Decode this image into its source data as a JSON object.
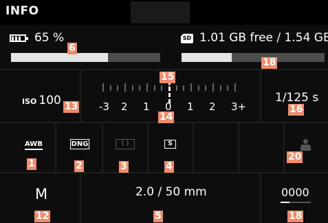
{
  "header": {
    "title": "INFO"
  },
  "battery": {
    "icon": "battery-icon",
    "text": "65 %",
    "level": 0.65
  },
  "storage": {
    "icon": "sd-card-icon",
    "sd_label": "SD",
    "text": "1.01 GB free / 1.54 GB",
    "used_fraction": 0.35
  },
  "exposure": {
    "iso_label": "ISO",
    "iso_value": "100",
    "scale_labels": [
      "-3",
      "2",
      "1",
      "0",
      "1",
      "2",
      "3+"
    ],
    "compensation": 0,
    "shutter": "1/125 s"
  },
  "settings": {
    "white_balance": "AWB",
    "file_format": "DNG",
    "metering_icon": "metering-center-weighted-icon",
    "metering_symbol": "( )",
    "drive_mode": "S",
    "profile_icon": "user-profile-icon"
  },
  "bottom": {
    "exposure_mode": "M",
    "lens": "2.0 / 50 mm",
    "frame_counter": "0000",
    "counter_level": 0.3
  },
  "callouts": [
    "6",
    "18",
    "15",
    "13",
    "14",
    "16",
    "1",
    "2",
    "3",
    "4",
    "20",
    "12",
    "5",
    "18"
  ],
  "colors": {
    "callout_bg": "#f08c6a",
    "bar_track": "#4d4d4d",
    "bar_fill": "#e5e5e5",
    "inactive": "#555555"
  }
}
